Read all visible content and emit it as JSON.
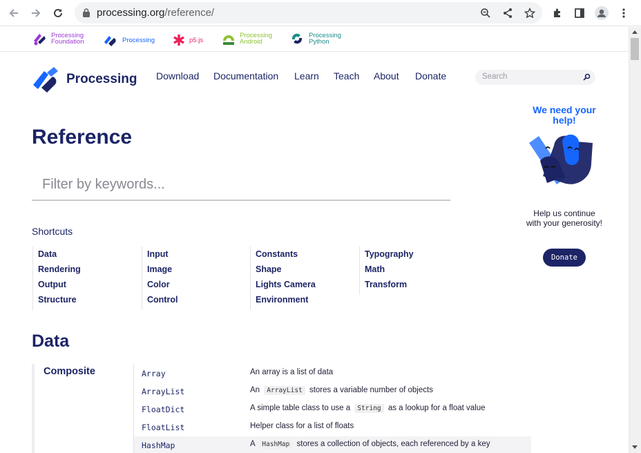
{
  "browser": {
    "url_domain": "processing.org",
    "url_path": "/reference/"
  },
  "top_projects": [
    {
      "label_line1": "Processing",
      "label_line2": "Foundation",
      "color": "#9b3bd6"
    },
    {
      "label_line1": "Processing",
      "label_line2": "",
      "color": "#1565ff"
    },
    {
      "label_line1": "p5.js",
      "label_line2": "",
      "color": "#ed225d"
    },
    {
      "label_line1": "Processing",
      "label_line2": "Android",
      "color": "#8fc333"
    },
    {
      "label_line1": "Processing",
      "label_line2": "Python",
      "color": "#1a8f8a"
    }
  ],
  "site": {
    "logo_text": "Processing",
    "nav": [
      "Download",
      "Documentation",
      "Learn",
      "Teach",
      "About",
      "Donate"
    ],
    "search_placeholder": "Search"
  },
  "main": {
    "title": "Reference",
    "filter_placeholder": "Filter by keywords...",
    "shortcuts_heading": "Shortcuts",
    "shortcut_columns": [
      [
        "Data",
        "Rendering",
        "Output",
        "Structure"
      ],
      [
        "Input",
        "Image",
        "Color",
        "Control"
      ],
      [
        "Constants",
        "Shape",
        "Lights Camera",
        "Environment"
      ],
      [
        "Typography",
        "Math",
        "Transform"
      ]
    ],
    "section_title": "Data",
    "category": "Composite",
    "rows": [
      {
        "name": "Array",
        "pre": "An array is a list of data",
        "code": "",
        "post": ""
      },
      {
        "name": "ArrayList",
        "pre": "An",
        "code": "ArrayList",
        "post": "stores a variable number of objects"
      },
      {
        "name": "FloatDict",
        "pre": "A simple table class to use a",
        "code": "String",
        "post": "as a lookup for a float value"
      },
      {
        "name": "FloatList",
        "pre": "Helper class for a list of floats",
        "code": "",
        "post": ""
      },
      {
        "name": "HashMap",
        "pre": "A",
        "code": "HashMap",
        "post": "stores a collection of objects, each referenced by a key"
      }
    ]
  },
  "sidebar": {
    "heading": "We need your help!",
    "text": "Help us continue with your generosity!",
    "donate_label": "Donate"
  },
  "colors": {
    "brand_navy": "#1c2466",
    "brand_blue": "#1565ff"
  }
}
